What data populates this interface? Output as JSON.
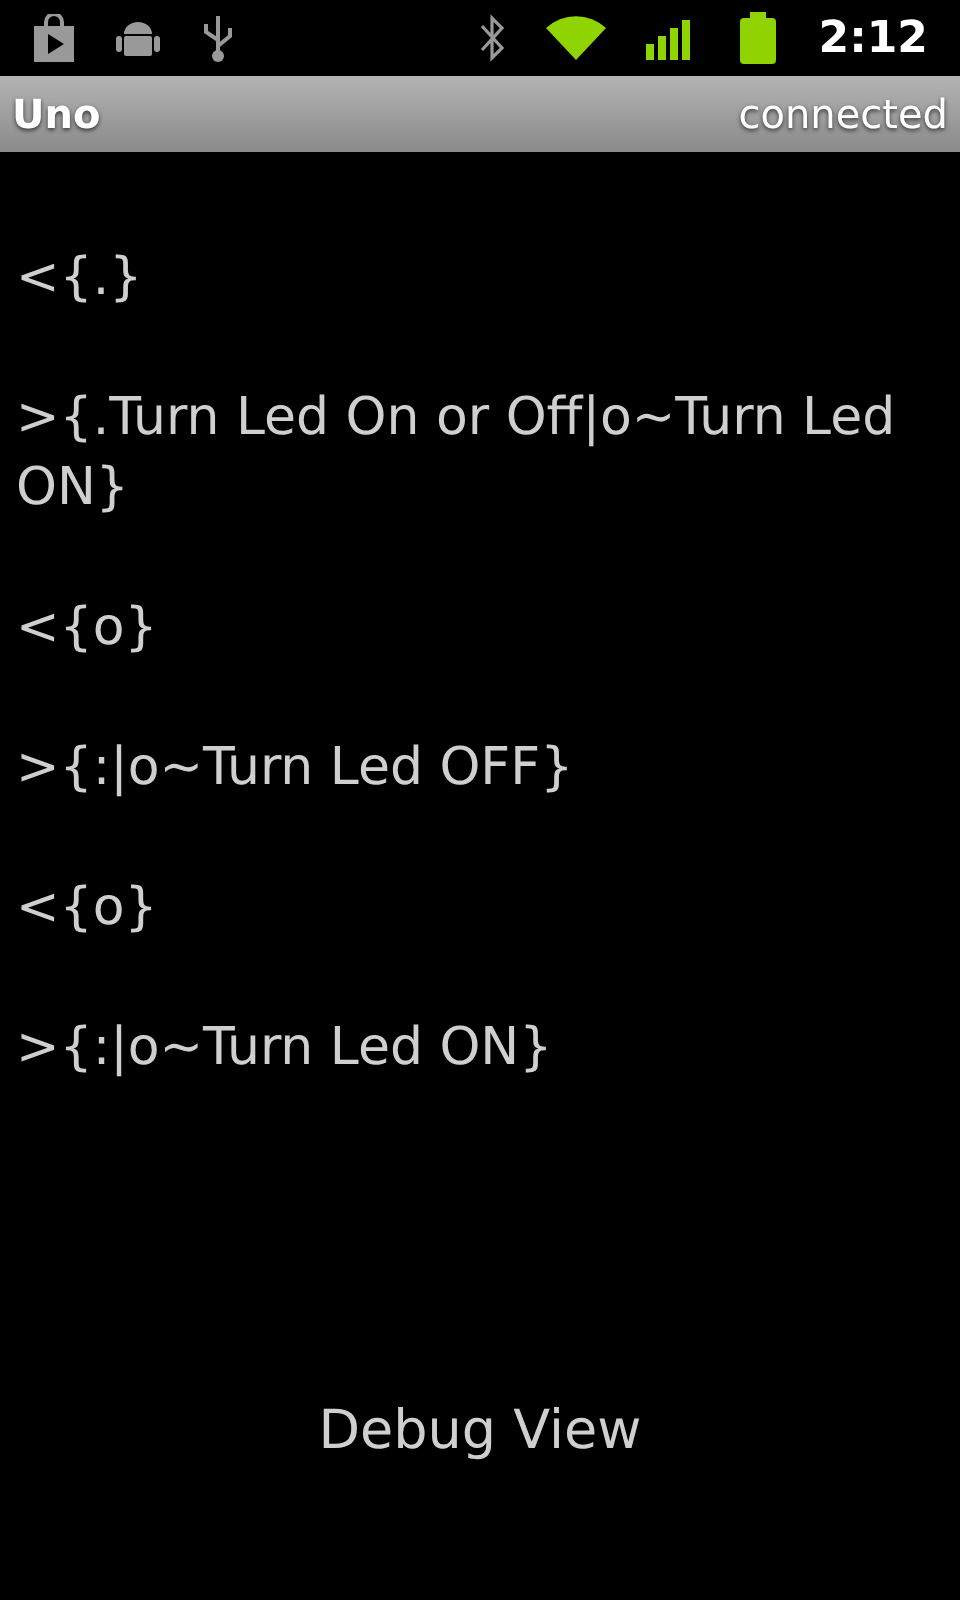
{
  "status_bar": {
    "time": "2:12"
  },
  "title_bar": {
    "title": "Uno",
    "status": "connected"
  },
  "log": [
    "<{.}",
    ">{.Turn Led On or Off|o~Turn Led ON}",
    "<{o}",
    ">{:|o~Turn Led OFF}",
    "<{o}",
    ">{:|o~Turn Led ON}"
  ],
  "footer": "Debug View"
}
